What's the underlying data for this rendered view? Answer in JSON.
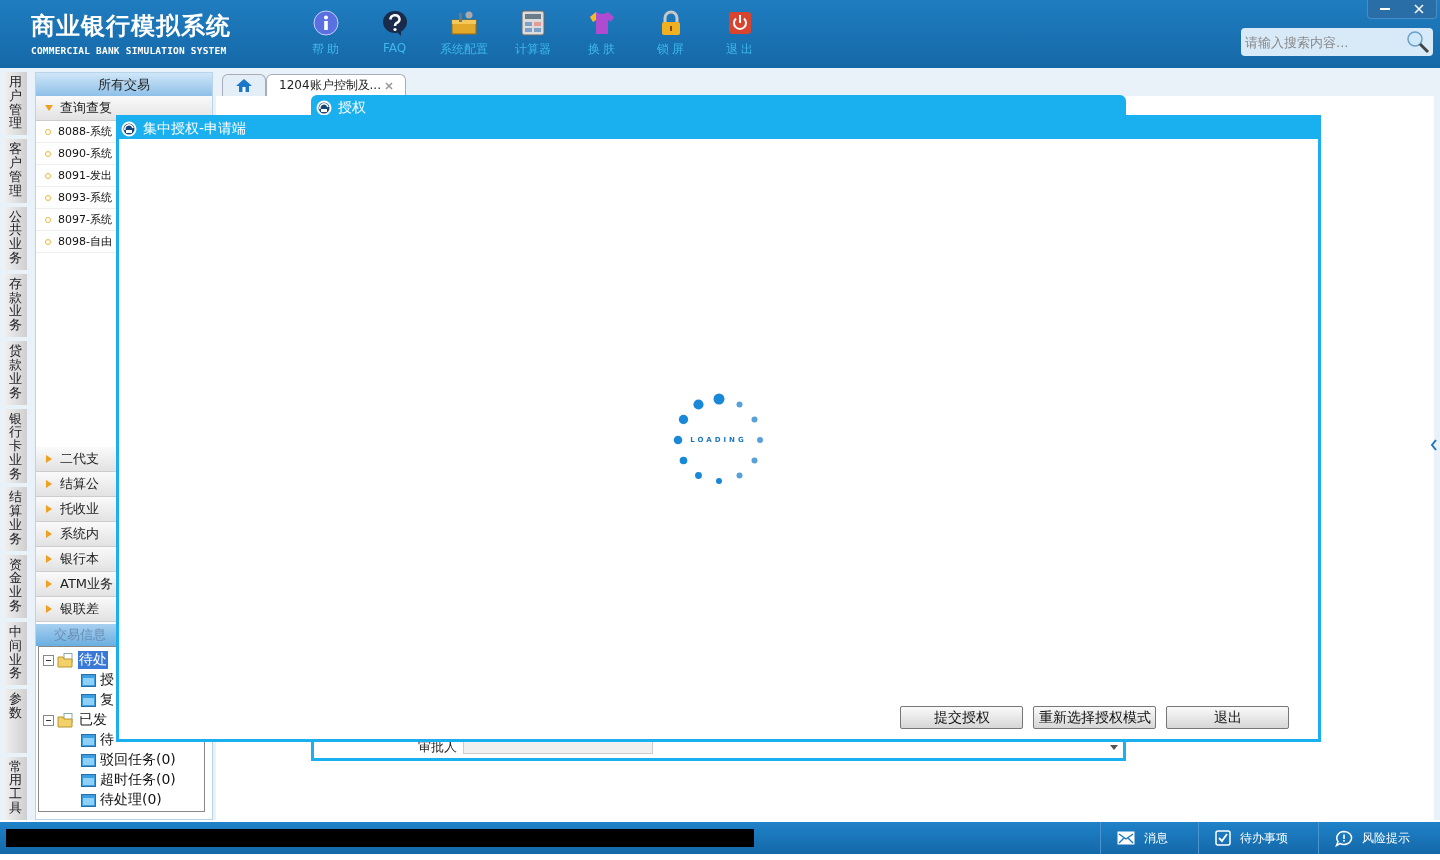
{
  "header": {
    "title": "商业银行模拟系统",
    "subtitle": "COMMERCIAL BANK SIMULATION SYSTEM",
    "toolbar": [
      {
        "kind": "info",
        "label": "帮 助"
      },
      {
        "kind": "faq",
        "label": "FAQ"
      },
      {
        "kind": "config",
        "label": "系统配置"
      },
      {
        "kind": "calculator",
        "label": "计算器"
      },
      {
        "kind": "skin",
        "label": "换 肤"
      },
      {
        "kind": "lock",
        "label": "锁 屏"
      },
      {
        "kind": "exit",
        "label": "退 出"
      }
    ],
    "search": {
      "placeholder": "请输入搜索内容..."
    }
  },
  "side_tabs": [
    "用户管理",
    "客户管理",
    "公共业务",
    "存款业务",
    "贷款业务",
    "银行卡业务",
    "结算业务",
    "资金业务",
    "中间业务",
    "参数",
    "常用工具"
  ],
  "sidebar": {
    "title": "所有交易",
    "groups": [
      {
        "label": "查询查复",
        "expanded": true,
        "items": [
          "8088-系统",
          "8090-系统",
          "8091-发出",
          "8093-系统",
          "8097-系统",
          "8098-自由"
        ]
      },
      {
        "label": "二代支",
        "expanded": false
      },
      {
        "label": "结算公",
        "expanded": false
      },
      {
        "label": "托收业",
        "expanded": false
      },
      {
        "label": "系统内",
        "expanded": false
      },
      {
        "label": "银行本",
        "expanded": false
      },
      {
        "label": "ATM业务",
        "expanded": false
      },
      {
        "label": "银联差",
        "expanded": false
      }
    ]
  },
  "info_panel": {
    "title": "交易信息",
    "tree": [
      {
        "label": "待处",
        "selected": true,
        "expanded": true,
        "children": [
          {
            "label": "授",
            "selected": false
          },
          {
            "label": "复",
            "selected": false
          }
        ]
      },
      {
        "label": "已发",
        "selected": false,
        "expanded": true,
        "children": [
          {
            "label": "待",
            "selected": false
          },
          {
            "label": "驳回任务(0)",
            "selected": false
          },
          {
            "label": "超时任务(0)",
            "selected": false
          },
          {
            "label": "待处理(0)",
            "selected": false
          }
        ]
      }
    ]
  },
  "tabs": [
    {
      "kind": "home",
      "selected": false
    },
    {
      "kind": "page",
      "label": "1204账户控制及...",
      "selected": true,
      "closable": true
    }
  ],
  "auth_dialog": {
    "title": "授权",
    "approver_label": "审批人"
  },
  "central_dialog": {
    "title": "集中授权-申请端",
    "loading_text": "LOADING",
    "buttons": [
      "提交授权",
      "重新选择授权模式",
      "退出"
    ]
  },
  "status_bar": {
    "items": [
      {
        "kind": "message",
        "label": "消息"
      },
      {
        "kind": "todo",
        "label": "待办事项"
      },
      {
        "kind": "risk",
        "label": "风险提示"
      }
    ]
  }
}
